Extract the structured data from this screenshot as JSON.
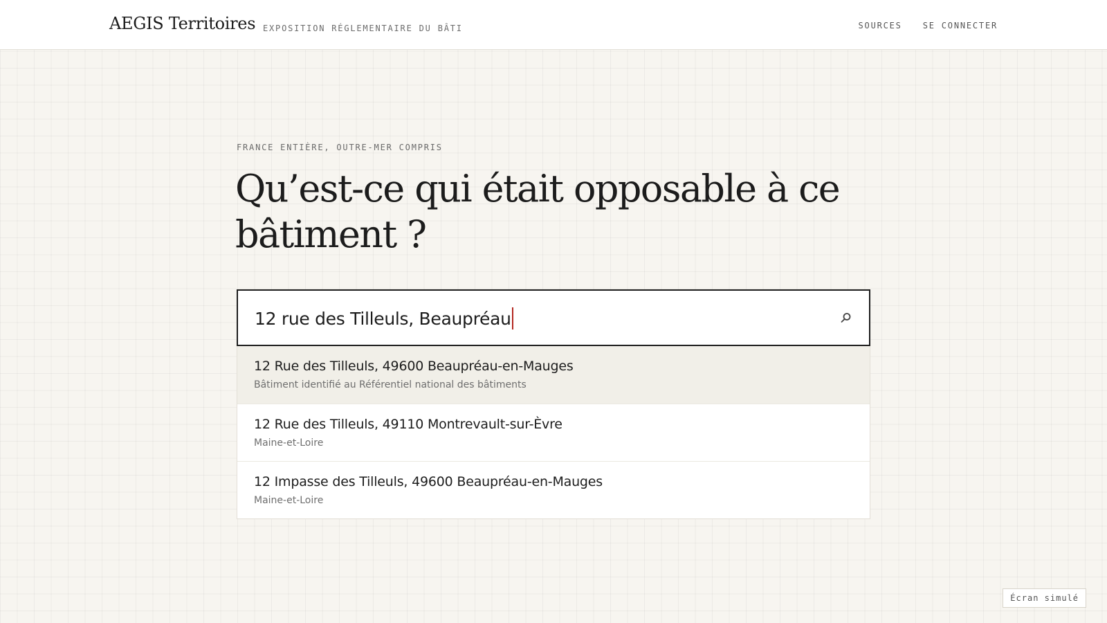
{
  "header": {
    "brand": "AEGIS Territoires",
    "tagline": "EXPOSITION RÉGLEMENTAIRE DU BÂTI",
    "nav": [
      "SOURCES",
      "SE CONNECTER"
    ]
  },
  "hero": {
    "eyebrow": "FRANCE ENTIÈRE, OUTRE-MER COMPRIS",
    "title": "Qu’est-ce qui était opposable à ce bâtiment ?"
  },
  "search": {
    "value": "12 rue des Tilleuls, Beaupréau",
    "icon": "search-icon"
  },
  "suggestions": [
    {
      "main": "12 Rue des Tilleuls, 49600 Beaupréau-en-Mauges",
      "sub": "Bâtiment identifié au Référentiel national des bâtiments",
      "active": true
    },
    {
      "main": "12 Rue des Tilleuls, 49110 Montrevault-sur-Èvre",
      "sub": "Maine-et-Loire",
      "active": false
    },
    {
      "main": "12 Impasse des Tilleuls, 49600 Beaupréau-en-Mauges",
      "sub": "Maine-et-Loire",
      "active": false
    }
  ],
  "badge": "Écran simulé",
  "colors": {
    "background": "#f7f5f0",
    "caret": "#b3261e",
    "active_row": "#f1efe8",
    "text": "#1c1c1c"
  }
}
